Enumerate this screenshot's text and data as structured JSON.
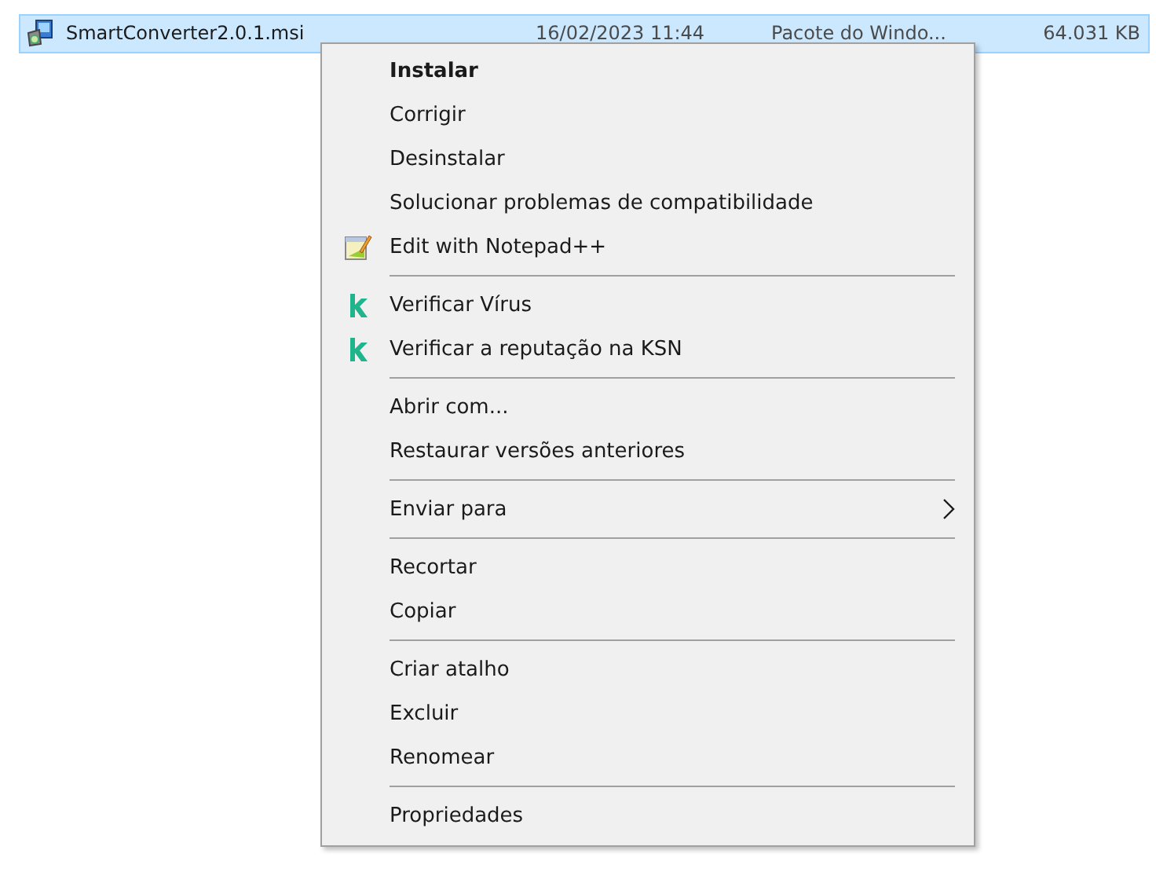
{
  "file_row": {
    "selected": true,
    "name": "SmartConverter2.0.1.msi",
    "date": "16/02/2023 11:44",
    "type": "Pacote do Windo...",
    "size": "64.031 KB"
  },
  "context_menu": {
    "groups": [
      {
        "items": [
          {
            "label": "Instalar",
            "default": true,
            "kind": "plain",
            "submenu": false
          },
          {
            "label": "Corrigir",
            "default": false,
            "kind": "plain",
            "submenu": false
          },
          {
            "label": "Desinstalar",
            "default": false,
            "kind": "plain",
            "submenu": false
          },
          {
            "label": "Solucionar problemas de compatibilidade",
            "default": false,
            "kind": "plain",
            "submenu": false
          },
          {
            "label": "Edit with Notepad++",
            "default": false,
            "kind": "notepad",
            "submenu": false
          }
        ]
      },
      {
        "items": [
          {
            "label": "Verificar Vírus",
            "default": false,
            "kind": "scan",
            "submenu": false
          },
          {
            "label": "Verificar a reputação na KSN",
            "default": false,
            "kind": "scan",
            "submenu": false
          }
        ]
      },
      {
        "items": [
          {
            "label": "Abrir com...",
            "default": false,
            "kind": "plain",
            "submenu": false
          },
          {
            "label": "Restaurar versões anteriores",
            "default": false,
            "kind": "plain",
            "submenu": false
          }
        ]
      },
      {
        "items": [
          {
            "label": "Enviar para",
            "default": false,
            "kind": "plain",
            "submenu": true
          }
        ]
      },
      {
        "items": [
          {
            "label": "Recortar",
            "default": false,
            "kind": "plain",
            "submenu": false
          },
          {
            "label": "Copiar",
            "default": false,
            "kind": "plain",
            "submenu": false
          }
        ]
      },
      {
        "items": [
          {
            "label": "Criar atalho",
            "default": false,
            "kind": "plain",
            "submenu": false
          },
          {
            "label": "Excluir",
            "default": false,
            "kind": "plain",
            "submenu": false
          },
          {
            "label": "Renomear",
            "default": false,
            "kind": "plain",
            "submenu": false
          }
        ]
      },
      {
        "items": [
          {
            "label": "Propriedades",
            "default": false,
            "kind": "plain",
            "submenu": false
          }
        ]
      }
    ]
  }
}
